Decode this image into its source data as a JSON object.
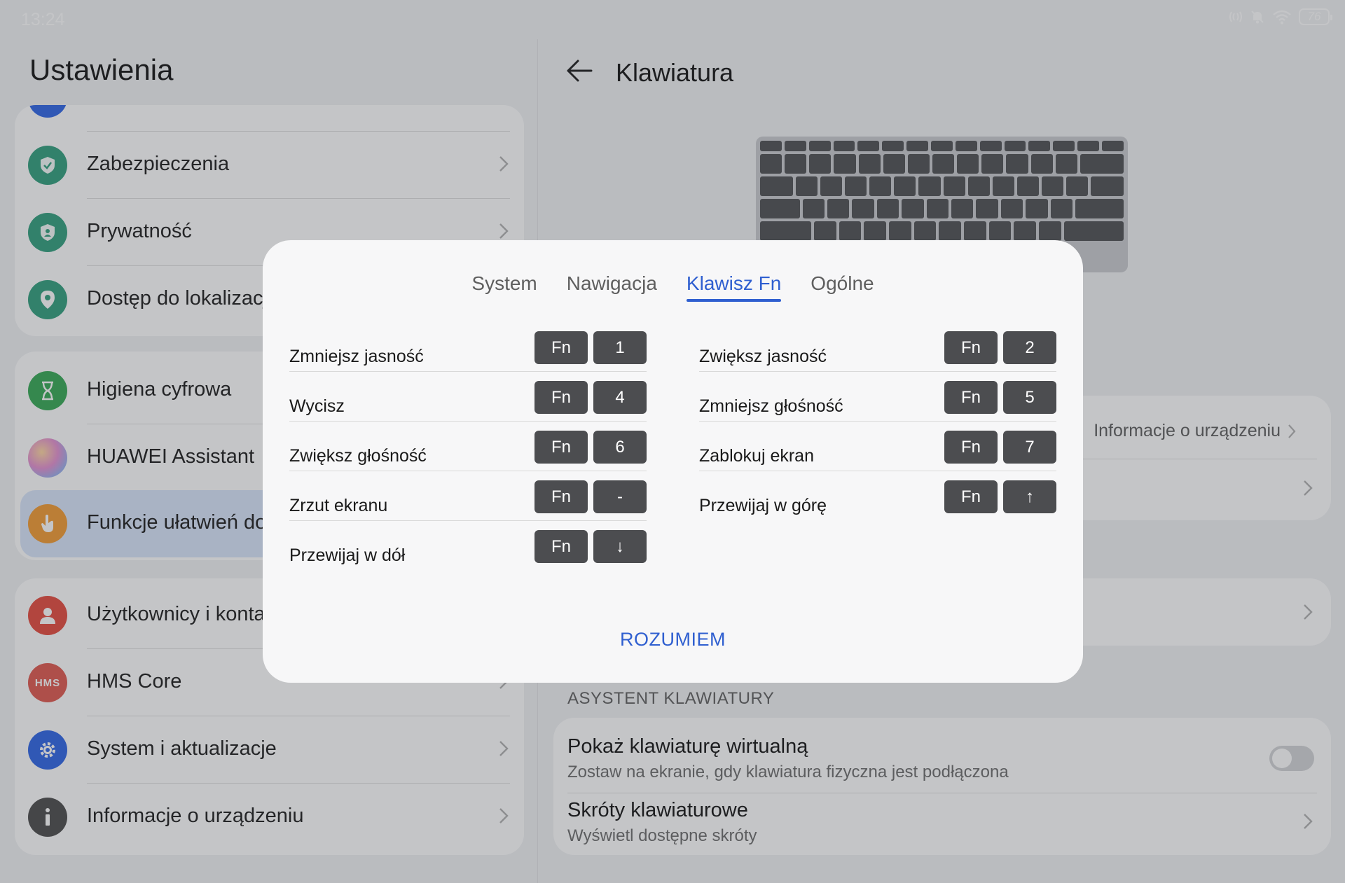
{
  "status_bar": {
    "time": "13:24",
    "battery": "76"
  },
  "left_panel": {
    "title": "Ustawienia",
    "group1": [
      {
        "label": "Zabezpieczenia",
        "icon": "shield-check-icon",
        "color": "#2f9e7b"
      },
      {
        "label": "Prywatność",
        "icon": "privacy-shield-icon",
        "color": "#2f9e7b"
      },
      {
        "label": "Dostęp do lokalizacji",
        "icon": "location-pin-icon",
        "color": "#2f9e7b"
      }
    ],
    "group2": [
      {
        "label": "Higiena cyfrowa",
        "icon": "hourglass-icon",
        "color": "#33a852"
      },
      {
        "label": "HUAWEI Assistant",
        "icon": "assistant-orb-icon",
        "color": "#b88ce0"
      },
      {
        "label": "Funkcje ułatwień dostępu",
        "icon": "hand-icon",
        "color": "#f29a30"
      }
    ],
    "group3": [
      {
        "label": "Użytkownicy i konta",
        "icon": "user-icon",
        "color": "#e5483c"
      },
      {
        "label": "HMS Core",
        "icon": "hms-icon",
        "icon_text": "HMS",
        "color": "#e0564d"
      },
      {
        "label": "System i aktualizacje",
        "icon": "gear-icon",
        "color": "#2c63e6"
      },
      {
        "label": "Informacje o urządzeniu",
        "icon": "info-icon",
        "color": "#4a4a4a"
      }
    ]
  },
  "right_panel": {
    "title": "Klawiatura",
    "device_info_link": "Informacje o urządzeniu",
    "section_label": "ASYSTENT KLAWIATURY",
    "settings": [
      {
        "title": "Pokaż klawiaturę wirtualną",
        "subtitle": "Zostaw na ekranie, gdy klawiatura fizyczna jest podłączona",
        "toggle": false
      },
      {
        "title": "Skróty klawiaturowe",
        "subtitle": "Wyświetl dostępne skróty"
      }
    ]
  },
  "dialog": {
    "tabs": [
      {
        "label": "System",
        "active": false
      },
      {
        "label": "Nawigacja",
        "active": false
      },
      {
        "label": "Klawisz Fn",
        "active": true
      },
      {
        "label": "Ogólne",
        "active": false
      }
    ],
    "left_column": [
      {
        "name": "Zmniejsz jasność",
        "keys": [
          "Fn",
          "1"
        ]
      },
      {
        "name": "Wycisz",
        "keys": [
          "Fn",
          "4"
        ]
      },
      {
        "name": "Zwiększ głośność",
        "keys": [
          "Fn",
          "6"
        ]
      },
      {
        "name": "Zrzut ekranu",
        "keys": [
          "Fn",
          "-"
        ]
      },
      {
        "name": "Przewijaj w dół",
        "keys": [
          "Fn",
          "↓"
        ]
      }
    ],
    "right_column": [
      {
        "name": "Zwiększ jasność",
        "keys": [
          "Fn",
          "2"
        ]
      },
      {
        "name": "Zmniejsz głośność",
        "keys": [
          "Fn",
          "5"
        ]
      },
      {
        "name": "Zablokuj ekran",
        "keys": [
          "Fn",
          "7"
        ]
      },
      {
        "name": "Przewijaj w górę",
        "keys": [
          "Fn",
          "↑"
        ]
      }
    ],
    "confirm_label": "ROZUMIEM"
  },
  "colors": {
    "accent": "#2f5fd0",
    "key_bg": "#4c4d50",
    "dialog_bg": "#f7f7f8"
  }
}
